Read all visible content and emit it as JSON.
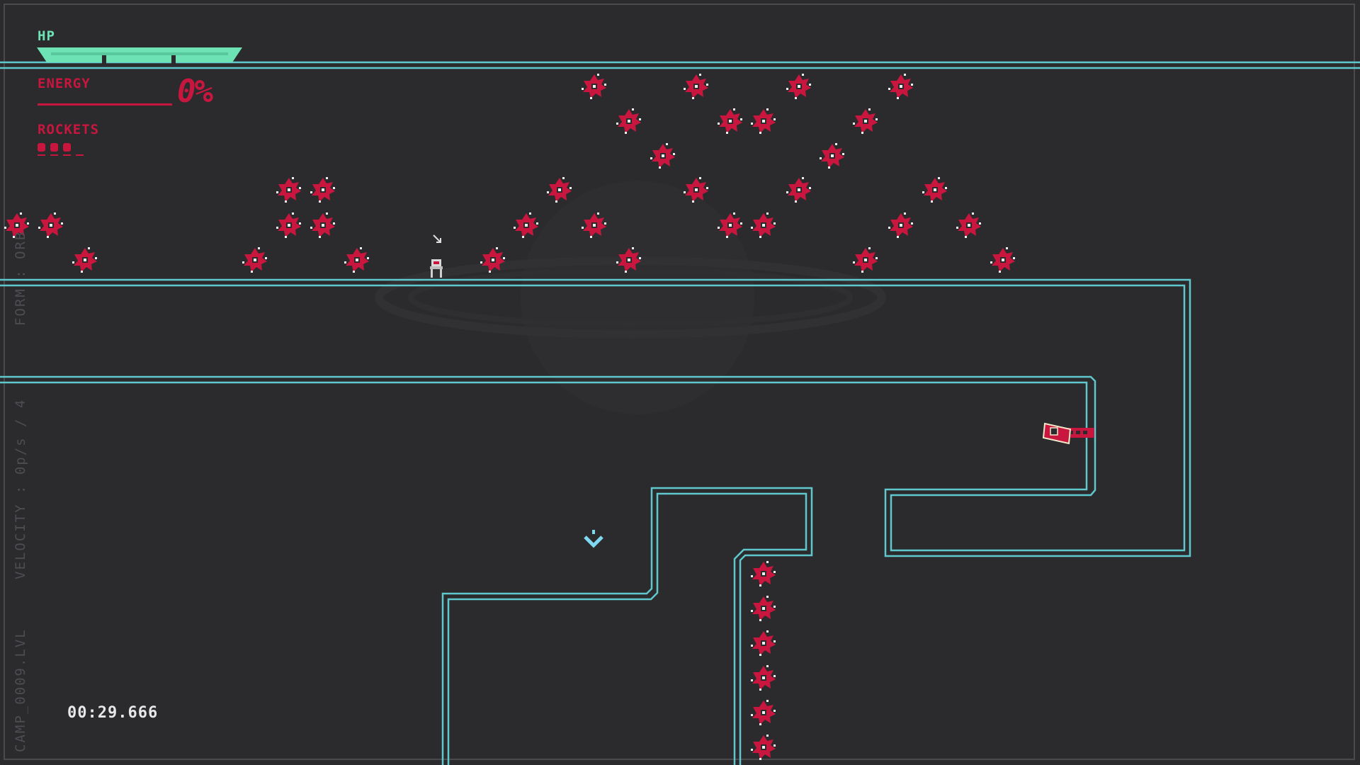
{
  "hud": {
    "hp_label": "HP",
    "hp_segments_filled": 3,
    "hp_segments_total": 3,
    "energy_label": "ENERGY",
    "energy_value": "0%",
    "rockets_label": "ROCKETS",
    "rockets_count": 3
  },
  "side_info": {
    "form": "FORM : ORB",
    "velocity": "VELOCITY : 0p/s / 4",
    "level": "CAMP_0009.LVL"
  },
  "timer": "00:29.666",
  "colors": {
    "background": "#2b2b2e",
    "wall": "#5ec8cc",
    "enemy": "#c8163e",
    "hp": "#6de3b5",
    "hud_red": "#c8163e",
    "player_marker": "#7fd8f0"
  },
  "icons": {
    "enemy": "spiked-mine-icon",
    "player": "player-robot-icon",
    "cursor": "aim-cursor-icon",
    "checkpoint": "checkpoint-chevron-icon",
    "turret": "rocket-turret-icon",
    "backdrop": "planet-backdrop"
  }
}
